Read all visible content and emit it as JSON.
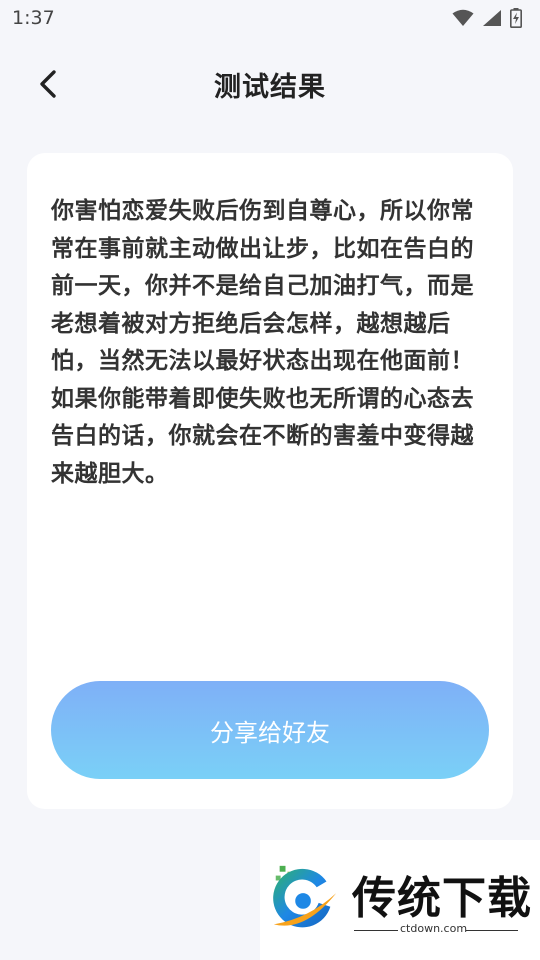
{
  "status_bar": {
    "time": "1:37",
    "icons": [
      "wifi-icon",
      "signal-icon",
      "battery-charging-icon"
    ]
  },
  "header": {
    "title": "测试结果",
    "back_icon": "chevron-left-icon"
  },
  "result": {
    "text": "你害怕恋爱失败后伤到自尊心，所以你常常在事前就主动做出让步，比如在告白的前一天，你并不是给自己加油打气，而是老想着被对方拒绝后会怎样，越想越后怕，当然无法以最好状态出现在他面前！如果你能带着即使失败也无所谓的心态去告白的话，你就会在不断的害羞中变得越来越胆大。"
  },
  "share_button": {
    "label": "分享给好友"
  },
  "watermark": {
    "title": "传统下载",
    "url": "ctdown.com"
  },
  "colors": {
    "background": "#f5f6fa",
    "card": "#ffffff",
    "button_gradient_top": "#7fb0f7",
    "button_gradient_bottom": "#7ad0f7"
  }
}
